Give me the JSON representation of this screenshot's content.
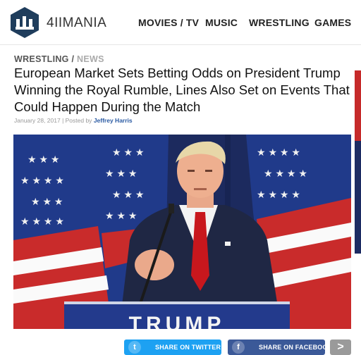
{
  "site": {
    "brand": "4IIMANIA",
    "nav": [
      "MOVIES / TV",
      "MUSIC",
      "WRESTLING",
      "GAMES"
    ]
  },
  "article": {
    "breadcrumb": {
      "section": "WRESTLING",
      "separator": " / ",
      "subsection": "NEWS"
    },
    "headline": "European Market Sets Betting Odds on President Trump Winning the Royal Rumble, Lines Also Set on Events That Could Happen During the Match",
    "meta": {
      "date": "January 28, 2017",
      "separator": " | Posted by ",
      "author": "Jeffrey Harris"
    },
    "photo": {
      "podium_text": "TRUMP"
    }
  },
  "share": {
    "twitter_label": "SHARE ON TWITTER",
    "twitter_icon": "t",
    "facebook_label": "SHARE ON FACEBOOK",
    "facebook_icon": "f",
    "more_icon": ">"
  },
  "colors": {
    "twitter": "#1da1f2",
    "facebook": "#3b5998",
    "logo": "#1f3d5c",
    "author_link": "#2a5aa3"
  }
}
